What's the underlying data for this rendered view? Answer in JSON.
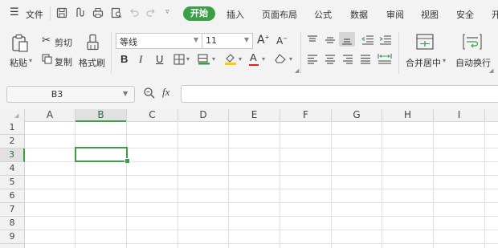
{
  "menu": {
    "file_label": "文件",
    "tabs": [
      "开始",
      "插入",
      "页面布局",
      "公式",
      "数据",
      "审阅",
      "视图",
      "安全",
      "开"
    ]
  },
  "ribbon": {
    "paste_label": "粘贴",
    "cut_label": "剪切",
    "copy_label": "复制",
    "format_painter_label": "格式刷",
    "font_name": "等线",
    "font_size": "11",
    "merge_center_label": "合并居中",
    "wrap_text_label": "自动换行",
    "bold": "B",
    "italic": "I",
    "underline": "U"
  },
  "formula_bar": {
    "name_box": "B3",
    "fx_label": "fx",
    "formula_value": ""
  },
  "sheet": {
    "columns": [
      "A",
      "B",
      "C",
      "D",
      "E",
      "F",
      "G",
      "H",
      "I"
    ],
    "rows": [
      "1",
      "2",
      "3",
      "4",
      "5",
      "6",
      "7",
      "8",
      "9"
    ],
    "selected_cell": "B3",
    "accent_color": "#3c9f48"
  }
}
